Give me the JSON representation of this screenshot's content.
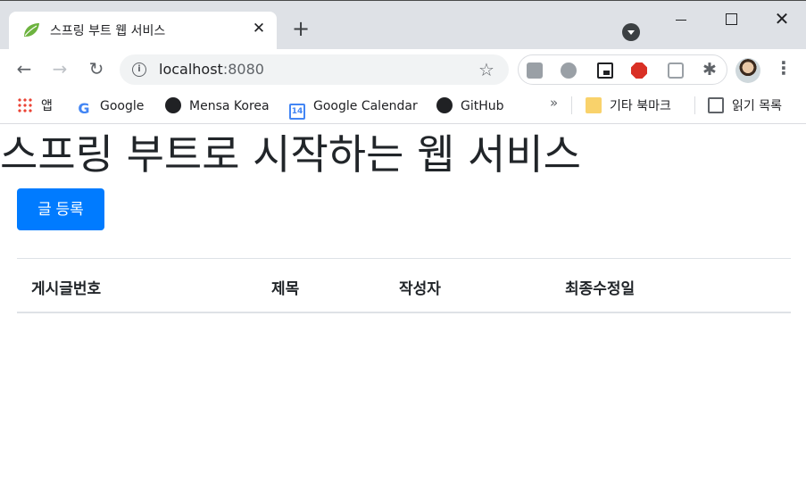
{
  "browser": {
    "tab": {
      "title": "스프링 부트 웹 서비스",
      "close_glyph": "✕",
      "favicon": "spring-leaf-icon"
    },
    "new_tab_glyph": "+",
    "window_controls": {
      "close_glyph": "✕"
    },
    "toolbar": {
      "back_glyph": "←",
      "forward_glyph": "→",
      "reload_glyph": "↻",
      "url_host": "localhost",
      "url_port": ":8080",
      "info_glyph": "i",
      "star_glyph": "☆",
      "puzzle_glyph": "✱",
      "menu_glyph": "⋮"
    },
    "bookmarks": {
      "apps": "앱",
      "items": [
        "Google",
        "Mensa Korea",
        "Google Calendar",
        "GitHub"
      ],
      "calendar_day": "14",
      "google_letter": "G",
      "overflow": "»",
      "other": "기타 북마크",
      "reading_list": "읽기 목록"
    }
  },
  "page": {
    "title": "스프링 부트로 시작하는 웹 서비스",
    "register_button": "글 등록",
    "table": {
      "headers": [
        "게시글번호",
        "제목",
        "작성자",
        "최종수정일"
      ],
      "rows": []
    }
  },
  "colors": {
    "primary": "#007bff",
    "tabstrip": "#dee1e6",
    "text": "#212529"
  }
}
